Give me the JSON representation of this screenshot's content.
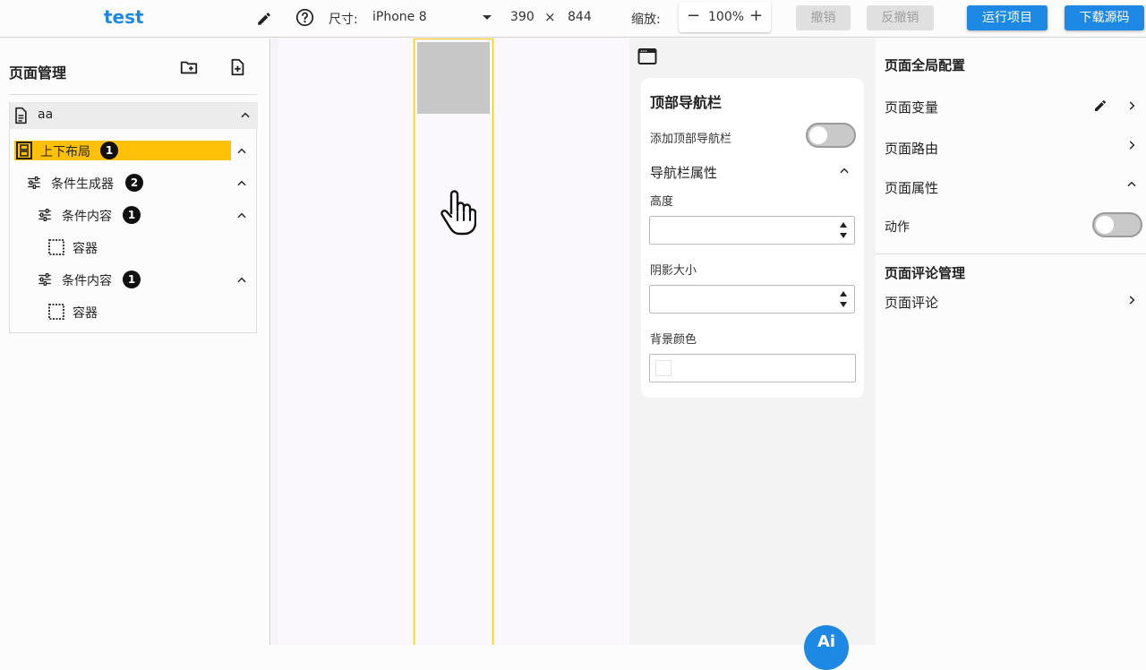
{
  "header": {
    "app_title": "test",
    "size_label": "尺寸:",
    "device": "iPhone 8",
    "width": "390",
    "times": "×",
    "height": "844",
    "zoom_label": "缩放:",
    "zoom_minus": "−",
    "zoom_value": "100%",
    "zoom_plus": "+",
    "undo_label": "撤销",
    "redo_label": "反撤销",
    "run_label": "运行项目",
    "download_label": "下载源码"
  },
  "left_panel": {
    "title": "页面管理",
    "page_name": "aa",
    "tree": [
      {
        "label": "上下布局",
        "badge": "1",
        "icon": "layout-vertical-icon"
      },
      {
        "label": "条件生成器",
        "badge": "2",
        "icon": "tune-icon"
      },
      {
        "label": "条件内容",
        "badge": "1",
        "icon": "tune-icon"
      },
      {
        "label": "容器",
        "icon": "container-icon"
      },
      {
        "label": "条件内容",
        "badge": "1",
        "icon": "tune-icon"
      },
      {
        "label": "容器",
        "icon": "container-icon"
      }
    ]
  },
  "props": {
    "title": "顶部导航栏",
    "add_navbar_label": "添加顶部导航栏",
    "add_navbar_enabled": false,
    "section_label": "导航栏属性",
    "height_label": "高度",
    "height_value": "",
    "shadow_label": "阴影大小",
    "shadow_value": "",
    "bg_color_label": "背景颜色",
    "ai_label": "Ai"
  },
  "right_panel": {
    "global_heading": "页面全局配置",
    "page_variables": "页面变量",
    "page_route": "页面路由",
    "page_properties": "页面属性",
    "action_label": "动作",
    "action_enabled": false,
    "comments_heading": "页面评论管理",
    "page_comments": "页面评论"
  },
  "colors": {
    "accent": "#1e88e5",
    "selection": "#ffc107",
    "disabled_bg": "#e0e0e0"
  }
}
